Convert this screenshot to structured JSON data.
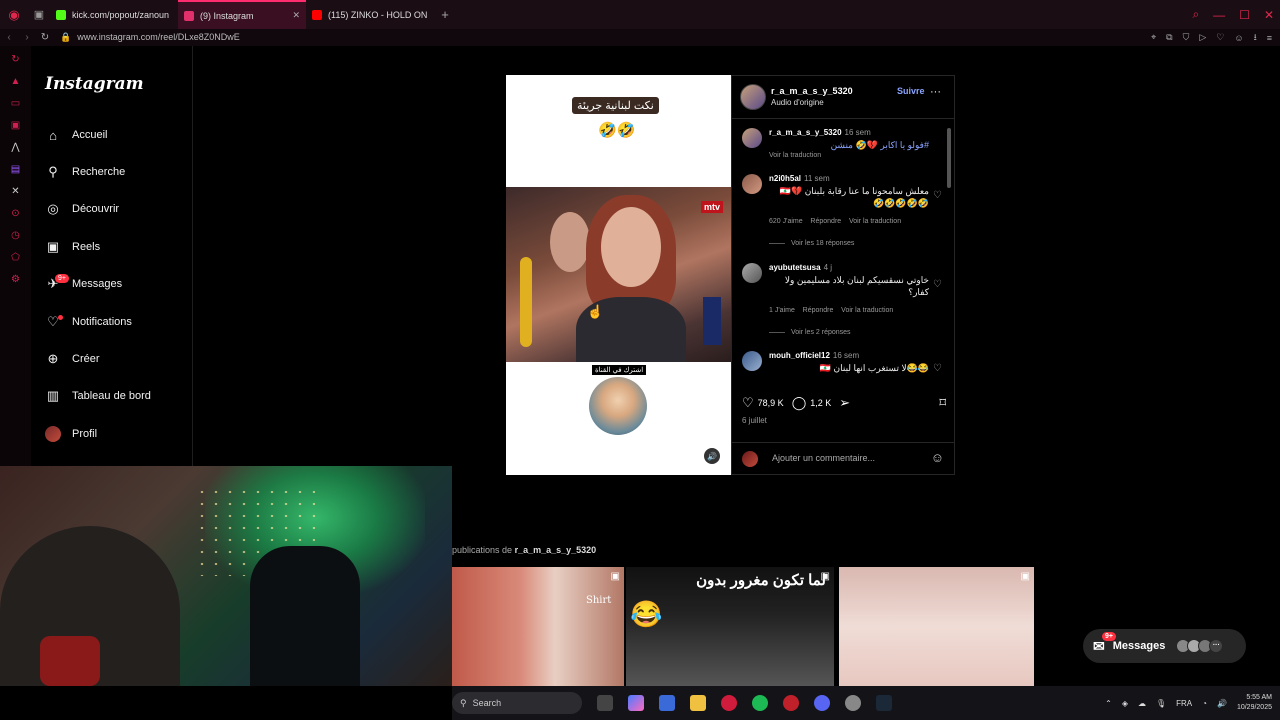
{
  "browser": {
    "tabs": [
      {
        "label": "kick.com/popout/zanoun",
        "favicon_color": "#53fc18"
      },
      {
        "label": "(9) Instagram",
        "favicon_color": "#e1306c",
        "active": true
      },
      {
        "label": "(115) ZINKO - HOLD ON",
        "favicon_color": "#ff0000"
      }
    ],
    "url": "www.instagram.com/reel/DLxe8Z0NDwE",
    "accent": "#ff2d6f"
  },
  "instagram": {
    "logo": "Instagram",
    "nav": [
      {
        "label": "Accueil",
        "icon": "home-icon"
      },
      {
        "label": "Recherche",
        "icon": "search-icon"
      },
      {
        "label": "Découvrir",
        "icon": "compass-icon"
      },
      {
        "label": "Reels",
        "icon": "reels-icon"
      },
      {
        "label": "Messages",
        "icon": "messenger-icon",
        "badge": "9+"
      },
      {
        "label": "Notifications",
        "icon": "heart-icon"
      },
      {
        "label": "Créer",
        "icon": "plus-icon"
      },
      {
        "label": "Tableau de bord",
        "icon": "chart-icon"
      },
      {
        "label": "Profil",
        "icon": "avatar"
      }
    ]
  },
  "post": {
    "video_caption": "نكت لبنانية جريئة",
    "video_emoji": "🤣🤣",
    "video_logo": "mtv",
    "subscribe_label": "اشترك في القناة",
    "author": "r_a_m_a_s_y_5320",
    "follow_label": "Suivre",
    "audio": "Audio d'origine",
    "likes": "78,9 K",
    "comments_count": "1,2 K",
    "date": "6 juillet",
    "add_comment_placeholder": "Ajouter un commentaire...",
    "comments": [
      {
        "user": "r_a_m_a_s_y_5320",
        "time": "16 sem",
        "text": "#فولو يا اكابر 💔🤣 منشن",
        "meta": "Voir la traduction"
      },
      {
        "user": "n2i0h5al",
        "time": "11 sem",
        "text": "معلش سامحونا ما عنا رقابة بلبنان 💔🇱🇧🤣🤣🤣🤣🤣",
        "likes": "620 J'aime",
        "reply": "Répondre",
        "translate": "Voir la traduction",
        "replies": "Voir les 18 réponses"
      },
      {
        "user": "ayubutetsusa",
        "time": "4 j",
        "text": "خاوتي نسقسيكم لبنان بلاد مسليمين ولا كفار؟",
        "likes": "1 J'aime",
        "reply": "Répondre",
        "translate": "Voir la traduction",
        "replies": "Voir les 2 réponses"
      },
      {
        "user": "mouh_officiel12",
        "time": "16 sem",
        "text": "😂😂لا تستغرب انها لبنان 🇱🇧"
      }
    ]
  },
  "more_posts": {
    "label_prefix": "publications de",
    "author": "r_a_m_a_s_y_5320",
    "thumb2_text": "لما تكون مغرور بدون",
    "thumb2_emoji": "😂",
    "thumb1_brand": "Shirt"
  },
  "messages_pill": {
    "label": "Messages",
    "badge": "9+",
    "more": "···"
  },
  "taskbar": {
    "search_label": "Search",
    "lang": "FRA",
    "time": "5:55 AM",
    "date": "10/29/2025"
  }
}
